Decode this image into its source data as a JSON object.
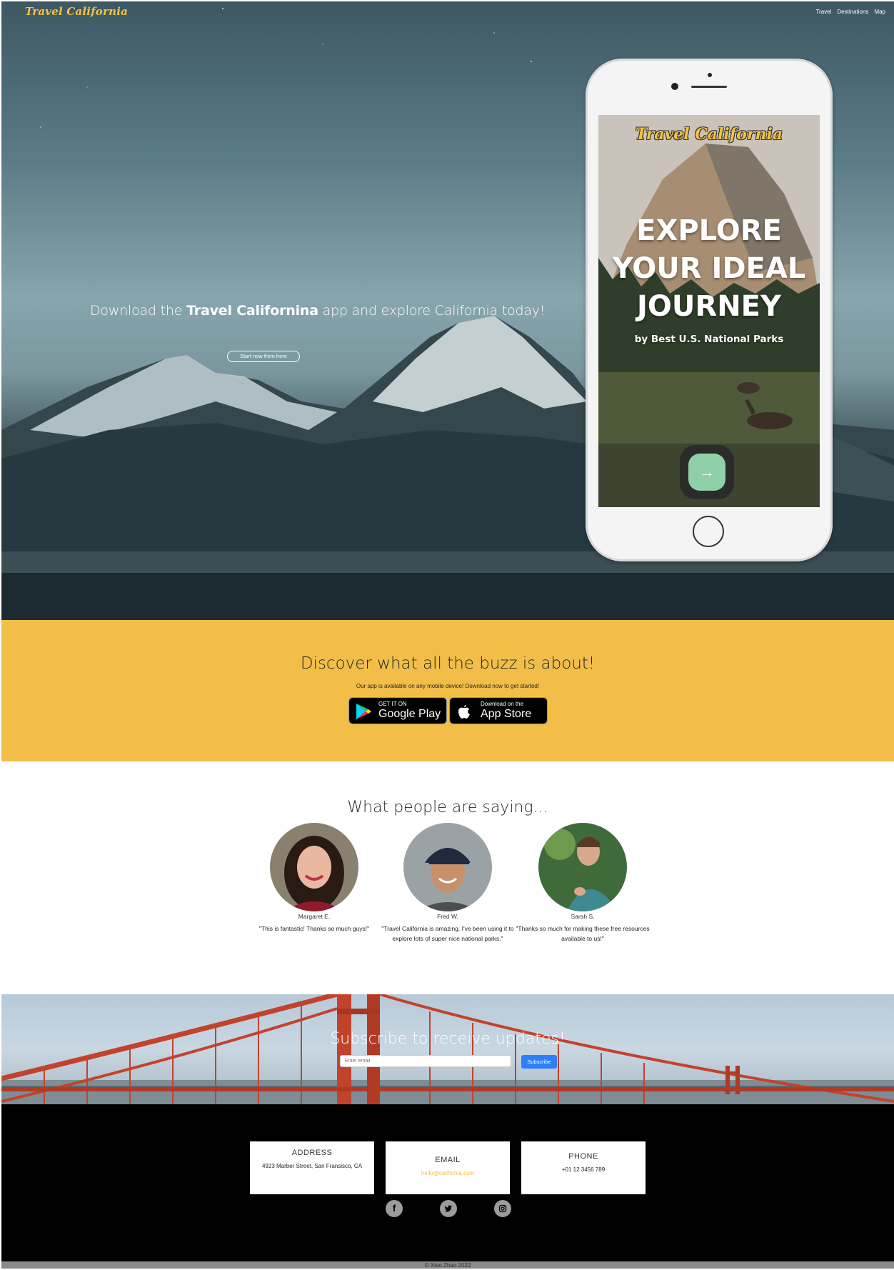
{
  "navbar": {
    "brand": "Travel California",
    "links": [
      "Travel",
      "Destinations",
      "Map"
    ]
  },
  "hero": {
    "text_prefix": "Download the ",
    "text_bold": "Travel Californina",
    "text_suffix": " app and explore California today!",
    "button_label": "Start now from here"
  },
  "phone_screen": {
    "logo": "Travel California",
    "headline_1": "EXPLORE",
    "headline_2": "YOUR IDEAL",
    "headline_3": "JOURNEY",
    "subtitle": "by Best U.S. National Parks",
    "arrow": "→"
  },
  "buzz": {
    "title": "Discover what all the buzz is about!",
    "subtitle": "Our app is available on any mobile device! Download now to get started!",
    "google_small": "GET IT ON",
    "google_big": "Google Play",
    "apple_small": "Download on the",
    "apple_big": "App Store"
  },
  "testimonials": {
    "title": "What people are saying...",
    "people": [
      {
        "name": "Margaret E.",
        "quote": "\"This is fantastic! Thanks so much guys!\""
      },
      {
        "name": "Fred W.",
        "quote": "\"Travel California is amazing. I've been using it to explore lots of super nice national parks.\""
      },
      {
        "name": "Sarah S.",
        "quote": "\"Thanks so much for making these free resources available to us!\""
      }
    ]
  },
  "subscribe": {
    "title": "Subscribe to receive updates!",
    "placeholder": "Enter email",
    "button_label": "Subscribe"
  },
  "footer": {
    "address_title": "ADDRESS",
    "address_value": "4923 Marber Street, San Fransisco, CA",
    "email_title": "EMAIL",
    "email_value": "hello@california.com",
    "phone_title": "PHONE",
    "phone_value": "+01 12 3456 789",
    "social": [
      "facebook-icon",
      "twitter-icon",
      "instagram-icon"
    ],
    "copyright": "© Xiao Zhao 2022"
  },
  "colors": {
    "brand": "#f5c242",
    "buzz_bg": "#f2be48",
    "subscribe_button": "#2d7ff9",
    "email_link": "#f2be48"
  }
}
